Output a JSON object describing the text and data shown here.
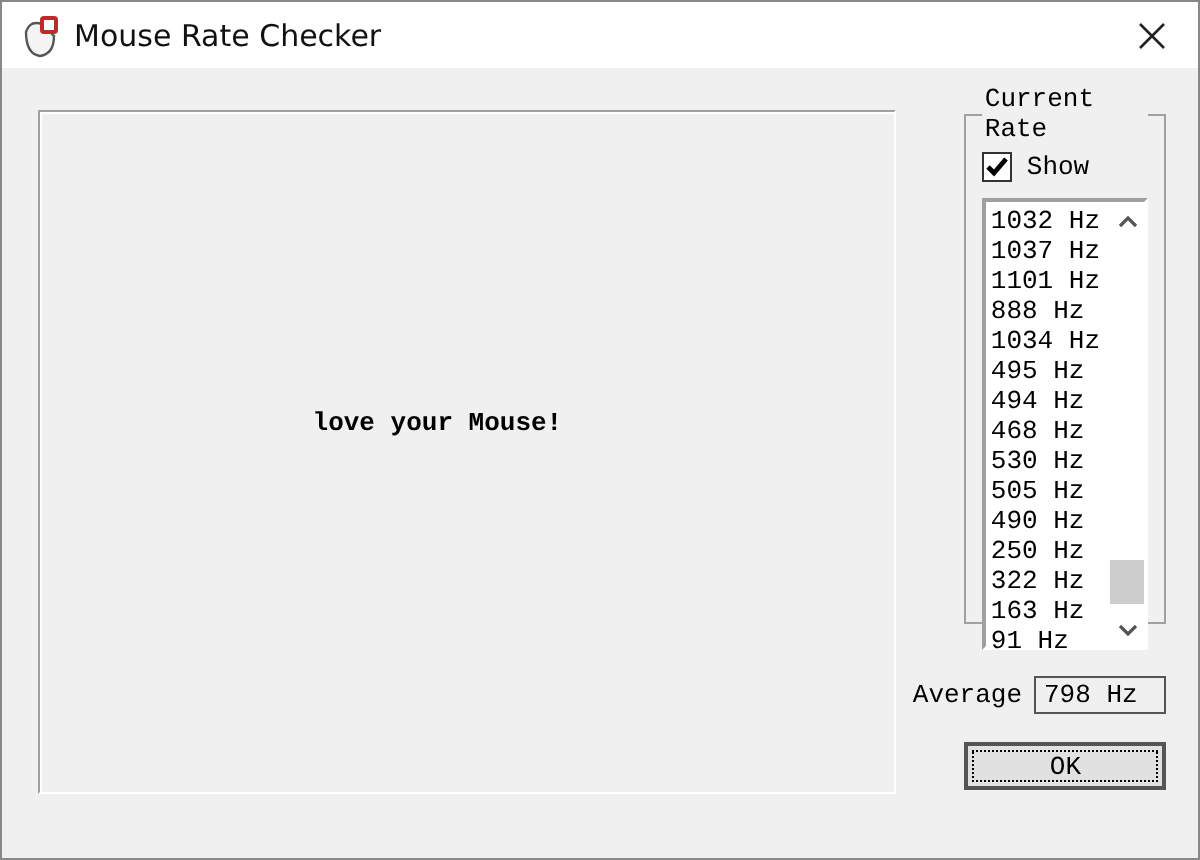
{
  "window": {
    "title": "Mouse Rate Checker"
  },
  "canvas": {
    "message": "love your Mouse!"
  },
  "current_rate": {
    "title": "Current Rate",
    "show": {
      "label": "Show",
      "checked": true
    },
    "readings": [
      "1032 Hz",
      "1037 Hz",
      "1101 Hz",
      "888 Hz",
      "1034 Hz",
      "495 Hz",
      "494 Hz",
      "468 Hz",
      "530 Hz",
      "505 Hz",
      "490 Hz",
      "250 Hz",
      "322 Hz",
      "163 Hz",
      "91 Hz"
    ]
  },
  "average": {
    "label": "Average",
    "value": "798 Hz"
  },
  "buttons": [
    "OK"
  ]
}
